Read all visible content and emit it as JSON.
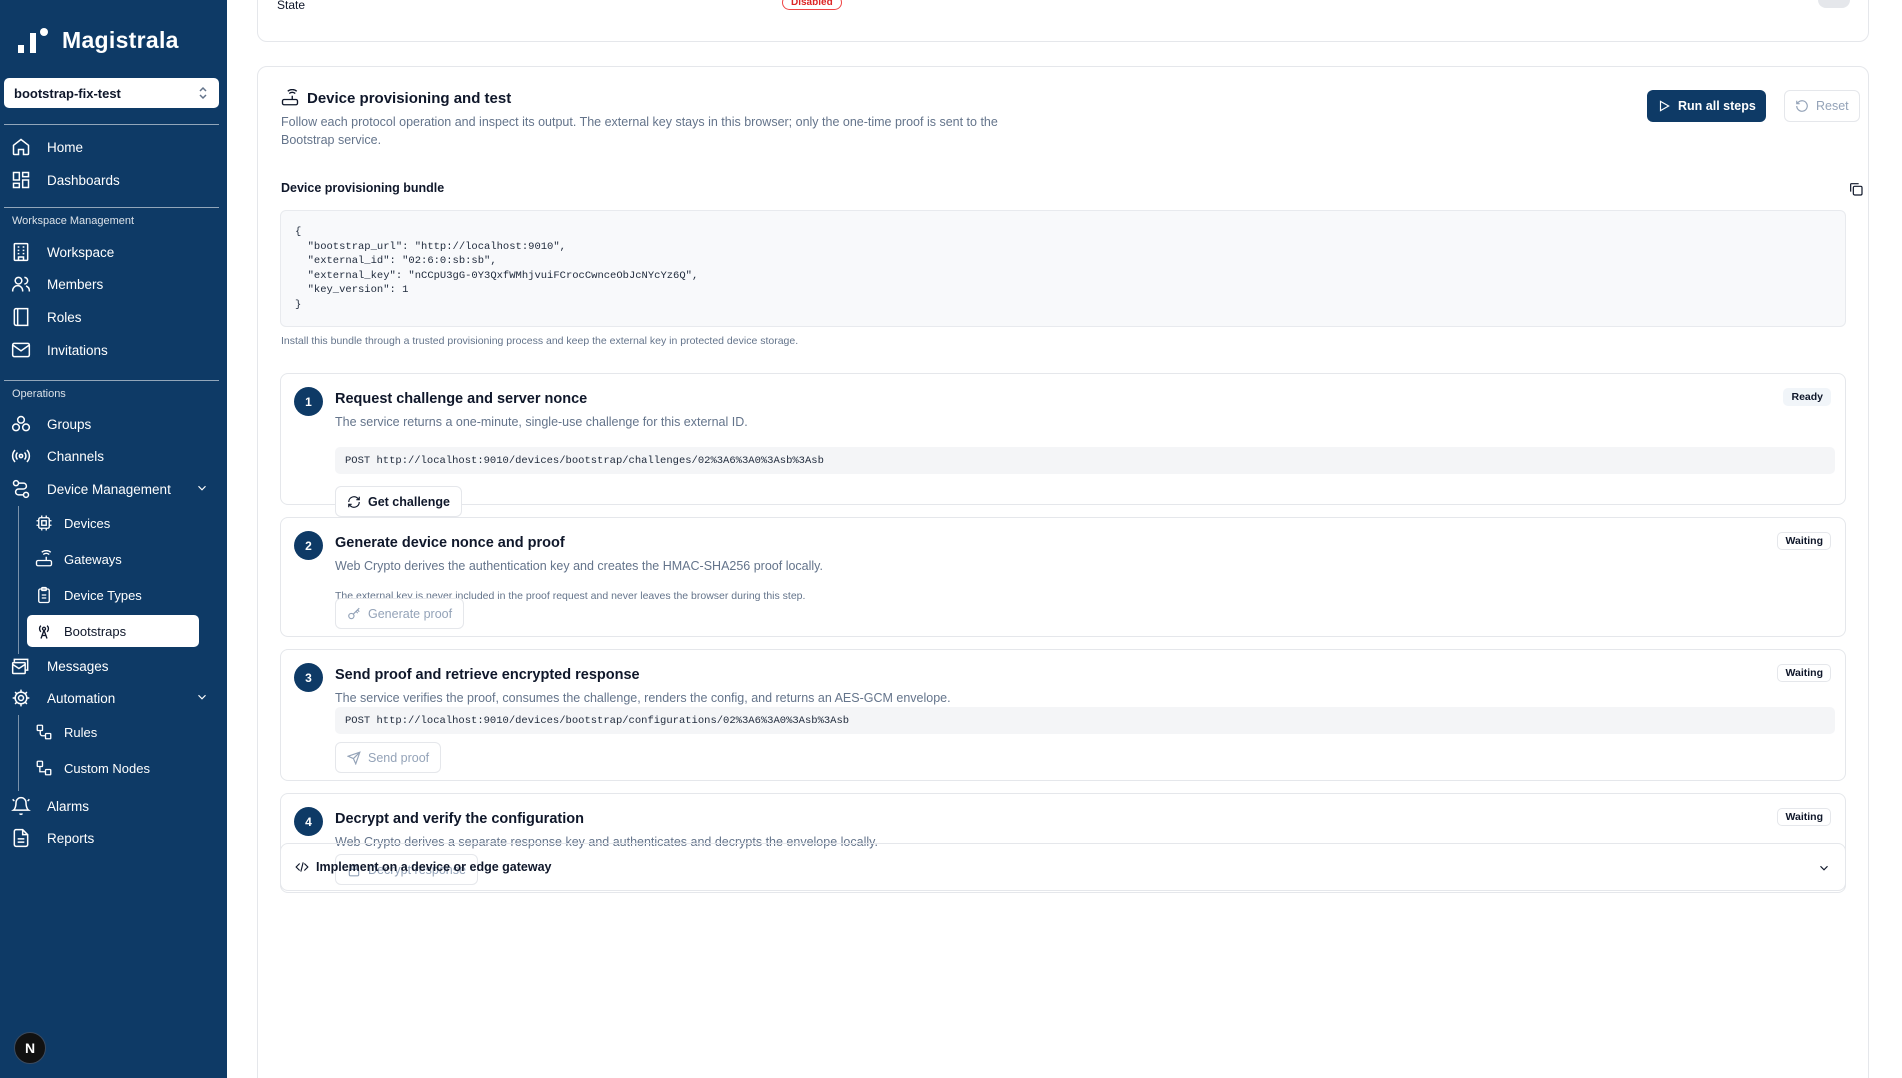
{
  "app": {
    "brand": "Magistrala"
  },
  "workspace": {
    "selected": "bootstrap-fix-test"
  },
  "sidebar": {
    "top_items": [
      {
        "label": "Home",
        "icon": "home-icon"
      },
      {
        "label": "Dashboards",
        "icon": "dashboards-icon"
      }
    ],
    "workspace_section": {
      "label": "Workspace Management",
      "items": [
        {
          "label": "Workspace",
          "icon": "building-icon"
        },
        {
          "label": "Members",
          "icon": "users-icon"
        },
        {
          "label": "Roles",
          "icon": "book-icon"
        },
        {
          "label": "Invitations",
          "icon": "mail-icon"
        }
      ]
    },
    "operations_section": {
      "label": "Operations",
      "items": [
        {
          "label": "Groups",
          "icon": "groups-icon"
        },
        {
          "label": "Channels",
          "icon": "radio-icon"
        },
        {
          "label": "Device Management",
          "icon": "route-icon"
        },
        {
          "label": "Messages",
          "icon": "messages-icon"
        },
        {
          "label": "Automation",
          "icon": "gear-icon"
        },
        {
          "label": "Alarms",
          "icon": "bell-icon"
        },
        {
          "label": "Reports",
          "icon": "file-icon"
        }
      ],
      "device_subitems": [
        {
          "label": "Devices",
          "icon": "chip-icon"
        },
        {
          "label": "Gateways",
          "icon": "router-icon"
        },
        {
          "label": "Device Types",
          "icon": "clipboard-icon"
        },
        {
          "label": "Bootstraps",
          "icon": "antenna-icon",
          "active": true
        }
      ],
      "automation_subitems": [
        {
          "label": "Rules",
          "icon": "workflow-icon"
        },
        {
          "label": "Custom Nodes",
          "icon": "nodes-icon"
        }
      ]
    },
    "avatar_letter": "N"
  },
  "top_card": {
    "state_label": "State",
    "state_value": "Disabled"
  },
  "provisioning": {
    "title": "Device provisioning and test",
    "description": "Follow each protocol operation and inspect its output. The external key stays in this browser; only the one-time proof is sent to the Bootstrap service.",
    "run_all_label": "Run all steps",
    "reset_label": "Reset",
    "bundle_title": "Device provisioning bundle",
    "bundle_code": "{\n  \"bootstrap_url\": \"http://localhost:9010\",\n  \"external_id\": \"02:6:0:sb:sb\",\n  \"external_key\": \"nCCpU3gG-0Y3QxfWMhjvuiFCrocCwnceObJcNYcYz6Q\",\n  \"key_version\": 1\n}",
    "bundle_note": "Install this bundle through a trusted provisioning process and keep the external key in protected device storage.",
    "steps": [
      {
        "number": "1",
        "title": "Request challenge and server nonce",
        "description": "The service returns a one-minute, single-use challenge for this external ID.",
        "status": "Ready",
        "endpoint": "POST http://localhost:9010/devices/bootstrap/challenges/02%3A6%3A0%3Asb%3Asb",
        "button": "Get challenge"
      },
      {
        "number": "2",
        "title": "Generate device nonce and proof",
        "description": "Web Crypto derives the authentication key and creates the HMAC-SHA256 proof locally.",
        "note": "The external key is never included in the proof request and never leaves the browser during this step.",
        "status": "Waiting",
        "button": "Generate proof"
      },
      {
        "number": "3",
        "title": "Send proof and retrieve encrypted response",
        "description": "The service verifies the proof, consumes the challenge, renders the config, and returns an AES-GCM envelope.",
        "status": "Waiting",
        "endpoint": "POST http://localhost:9010/devices/bootstrap/configurations/02%3A6%3A0%3Asb%3Asb",
        "button": "Send proof"
      },
      {
        "number": "4",
        "title": "Decrypt and verify the configuration",
        "description": "Web Crypto derives a separate response key and authenticates and decrypts the envelope locally.",
        "status": "Waiting",
        "button": "Decrypt response"
      }
    ],
    "implement_label": "Implement on a device or edge gateway"
  }
}
